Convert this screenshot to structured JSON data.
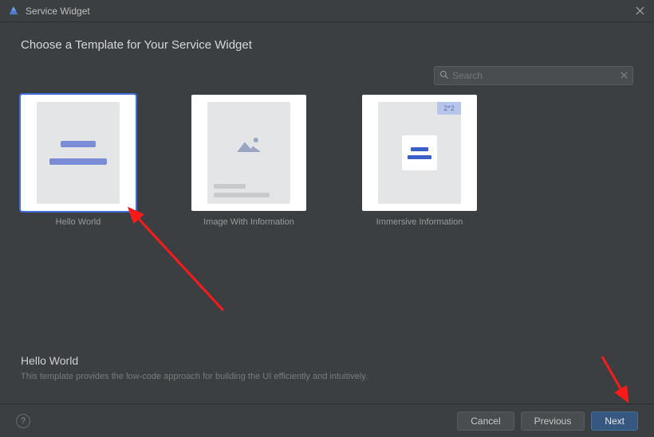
{
  "titlebar": {
    "title": "Service Widget"
  },
  "heading": "Choose a Template for Your Service Widget",
  "search": {
    "placeholder": "Search",
    "value": ""
  },
  "templates": [
    {
      "label": "Hello World",
      "selected": true
    },
    {
      "label": "Image With Information",
      "selected": false
    },
    {
      "label": "Immersive Information",
      "selected": false,
      "badge": "2*2"
    }
  ],
  "selected": {
    "title": "Hello World",
    "description": "This template provides the low-code approach for building the UI efficiently and intuitively."
  },
  "footer": {
    "cancel": "Cancel",
    "previous": "Previous",
    "next": "Next"
  }
}
